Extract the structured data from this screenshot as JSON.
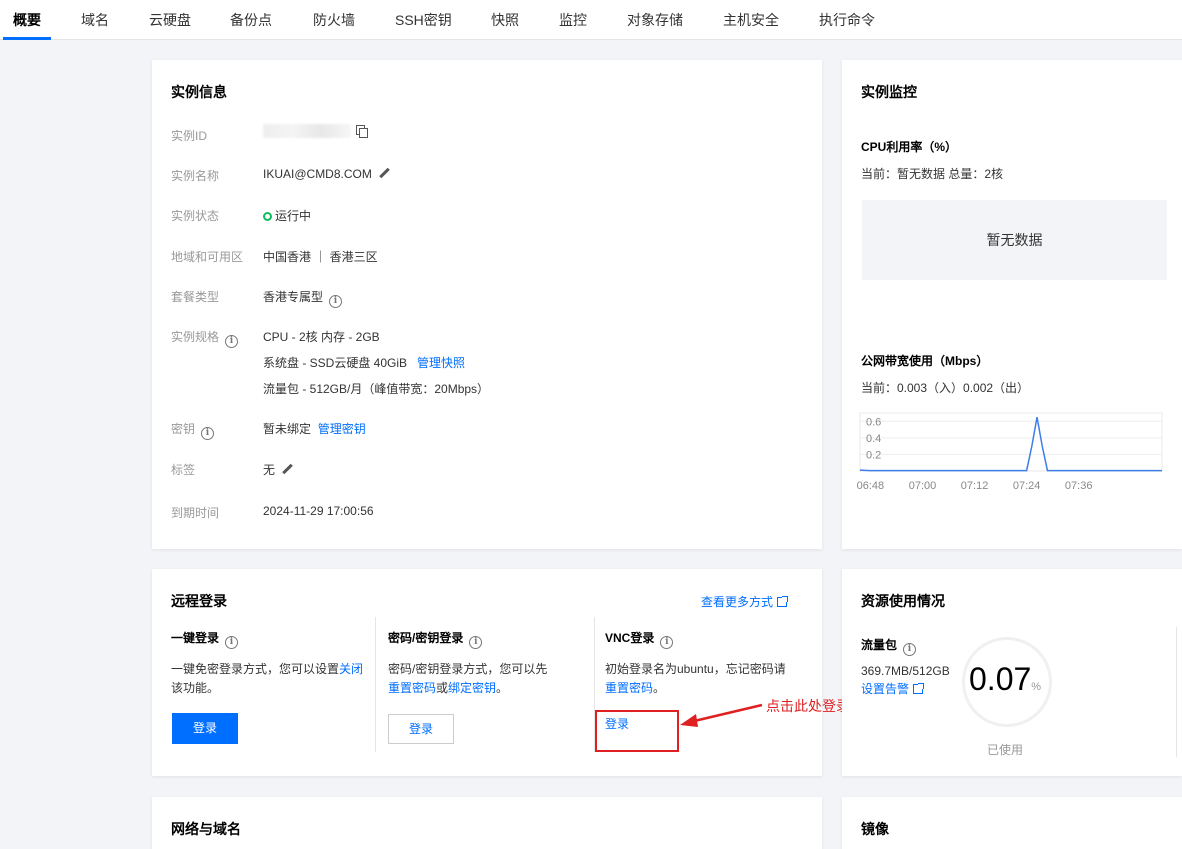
{
  "tabs": [
    {
      "label": "概要"
    },
    {
      "label": "域名"
    },
    {
      "label": "云硬盘"
    },
    {
      "label": "备份点"
    },
    {
      "label": "防火墙"
    },
    {
      "label": "SSH密钥"
    },
    {
      "label": "快照"
    },
    {
      "label": "监控"
    },
    {
      "label": "对象存储"
    },
    {
      "label": "主机安全"
    },
    {
      "label": "执行命令"
    }
  ],
  "instance": {
    "title": "实例信息",
    "id_label": "实例ID",
    "name_label": "实例名称",
    "name_value": "IKUAI@CMD8.COM",
    "status_label": "实例状态",
    "status_value": "运行中",
    "region_label": "地域和可用区",
    "region_value": "中国香港 ｜ 香港三区",
    "package_label": "套餐类型",
    "package_value": "香港专属型",
    "spec_label": "实例规格",
    "spec_cpu": "CPU - 2核 内存 - 2GB",
    "spec_disk": "系统盘 - SSD云硬盘 40GiB",
    "spec_disk_link": "管理快照",
    "spec_traffic": "流量包 - 512GB/月（峰值带宽：20Mbps）",
    "key_label": "密钥",
    "key_value": "暂未绑定",
    "key_link": "管理密钥",
    "tag_label": "标签",
    "tag_value": "无",
    "expire_label": "到期时间",
    "expire_value": "2024-11-29 17:00:56"
  },
  "monitor": {
    "title": "实例监控",
    "cpu_title": "CPU利用率（%）",
    "cpu_current": "当前：暂无数据 总量：2核",
    "cpu_empty": "暂无数据",
    "bw_title": "公网带宽使用（Mbps）",
    "bw_current": "当前：0.003（入）0.002（出）"
  },
  "chart_data": {
    "type": "line",
    "title": "公网带宽使用（Mbps）",
    "x_ticks": [
      "06:48",
      "07:00",
      "07:12",
      "07:24",
      "07:36"
    ],
    "y_ticks": [
      "0.2",
      "0.4",
      "0.6"
    ],
    "ylim": [
      0,
      0.7
    ],
    "series": [
      {
        "color": "#3d7ee6",
        "x": [
          0,
          2,
          4,
          6,
          8,
          10,
          12,
          14,
          16,
          18,
          20,
          22,
          24,
          26,
          28,
          30,
          32,
          33,
          34,
          35,
          36,
          38,
          40,
          42,
          44,
          46,
          48,
          50,
          52,
          54,
          56,
          58
        ],
        "values": [
          0.01,
          0.005,
          0.005,
          0.004,
          0.005,
          0.004,
          0.005,
          0.004,
          0.005,
          0.004,
          0.005,
          0.004,
          0.005,
          0.004,
          0.005,
          0.004,
          0.005,
          0.3,
          0.65,
          0.3,
          0.005,
          0.004,
          0.005,
          0.004,
          0.005,
          0.004,
          0.005,
          0.004,
          0.005,
          0.004,
          0.005,
          0.004
        ]
      }
    ],
    "grid": true
  },
  "remote": {
    "title": "远程登录",
    "more_link": "查看更多方式",
    "onekey_title": "一键登录",
    "onekey_desc_1": "一键免密登录方式，您可以设置",
    "onekey_desc_link": "关闭",
    "onekey_desc_2": "该功能。",
    "onekey_btn": "登录",
    "pwd_title": "密码/密钥登录",
    "pwd_desc_1": "密码/密钥登录方式，您可以先",
    "pwd_desc_link1": "重置密码",
    "pwd_desc_or": "或",
    "pwd_desc_link2": "绑定密钥",
    "pwd_desc_end": "。",
    "pwd_btn": "登录",
    "vnc_title": "VNC登录",
    "vnc_desc_1": "初始登录名为ubuntu，忘记密码请",
    "vnc_desc_link": "重置密码",
    "vnc_desc_end": "。",
    "vnc_btn": "登录",
    "annotation": "点击此处登录"
  },
  "resource": {
    "title": "资源使用情况",
    "traffic_title": "流量包",
    "traffic_value": "369.7MB/512GB",
    "alarm_link": "设置告警",
    "percent_value": "0.07",
    "percent_unit": "%",
    "used_label": "已使用"
  },
  "network": {
    "title": "网络与域名"
  },
  "image": {
    "title": "镜像"
  },
  "colors": {
    "accent": "#006eff",
    "status": "#0abf5b",
    "annotation": "#e02020"
  }
}
